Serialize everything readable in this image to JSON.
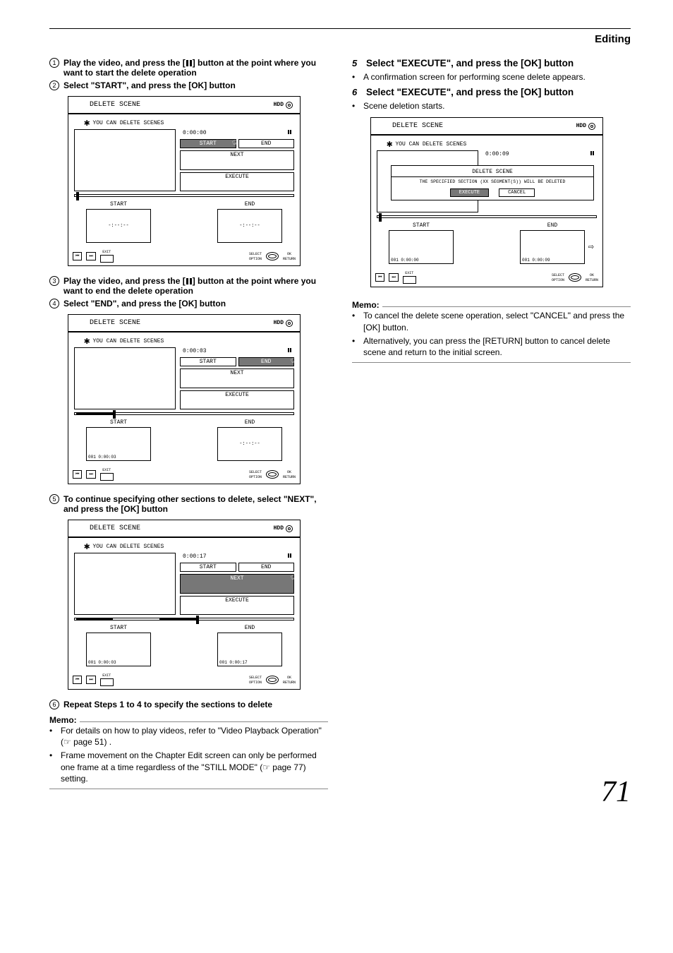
{
  "header": {
    "section": "Editing"
  },
  "left": {
    "step1": "Play the video, and press the [",
    "step1b": "] button at the point where you want to start the delete operation",
    "step2": "Select \"START\", and press the [OK] button",
    "step3": "Play the video, and press the [",
    "step3b": "] button at the point where you want to end the delete operation",
    "step4": "Select \"END\", and press the [OK] button",
    "step5": "To continue specifying other sections to delete, select \"NEXT\", and press the [OK] button",
    "step6": "Repeat Steps 1 to 4 to specify the sections to delete",
    "memo_label": "Memo:",
    "memo1": "For details on how to play videos, refer to \"Video Playback Operation\" (☞ page 51) .",
    "memo2": "Frame movement on the Chapter Edit screen can only be performed one frame at a time regardless of the \"STILL MODE\" (☞ page 77) setting."
  },
  "right": {
    "step5": "Select \"EXECUTE\", and press the [OK] button",
    "step5_sub": "A confirmation screen for performing scene delete appears.",
    "step6": "Select \"EXECUTE\", and press the [OK] button",
    "step6_sub": "Scene deletion starts.",
    "memo_label": "Memo:",
    "memo1": "To cancel the delete scene operation, select \"CANCEL\" and press the [OK] button.",
    "memo2": "Alternatively, you can press the [RETURN] button to cancel delete scene and return to the initial screen."
  },
  "osd": {
    "title": "DELETE SCENE",
    "hdd": "HDD",
    "msg": "YOU CAN DELETE SCENES",
    "btn_start": "START",
    "btn_end": "END",
    "btn_next": "NEXT",
    "btn_execute": "EXECUTE",
    "btn_cancel": "CANCEL",
    "thumb_start": "START",
    "thumb_end": "END",
    "placeholder": "-:--:--",
    "ft_exit": "EXIT",
    "ft_select": "SELECT",
    "ft_ok": "OK",
    "ft_option": "OPTION",
    "ft_return": "RETURN",
    "ft_skip_prev": "⏮",
    "ft_skip_next": "⏭",
    "dialog_title": "DELETE SCENE",
    "dialog_msg": "THE SPECIFIED SECTION (XX SEGMENT(S)) WILL BE DELETED",
    "p1": {
      "time": "0:00:00"
    },
    "p2": {
      "time": "0:00:03",
      "seg": "001  0:00:03"
    },
    "p3": {
      "time": "0:00:17",
      "seg_s": "001  0:00:03",
      "seg_e": "001  0:00:17"
    },
    "p4": {
      "time": "0:00:09",
      "seg_s": "001  0:00:00",
      "seg_e": "001  0:00:09"
    }
  },
  "page": "71"
}
